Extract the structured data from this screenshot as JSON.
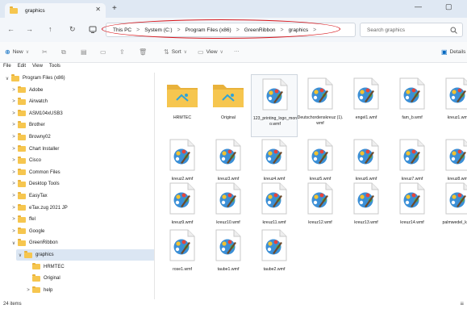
{
  "window": {
    "tab_title": "graphics",
    "close_glyph": "✕",
    "new_tab_glyph": "+",
    "minimize_glyph": "—",
    "maximize_glyph": "▢"
  },
  "nav": {
    "back": "←",
    "forward": "→",
    "up": "↑",
    "refresh": "↻",
    "breadcrumb": [
      "This PC",
      "System (C:)",
      "Program Files (x86)",
      "GreenRibbon",
      "graphics"
    ],
    "separator": ">",
    "search_placeholder": "Search graphics",
    "highlight_color": "#d6151b"
  },
  "toolbar": {
    "new_label": "New",
    "sort_label": "Sort",
    "view_label": "View",
    "more_label": "···",
    "details_label": "Details"
  },
  "menubar": [
    "File",
    "Edit",
    "View",
    "Tools"
  ],
  "sidebar": {
    "items": [
      {
        "label": "Program Files (x86)",
        "chev": "∨"
      },
      {
        "label": "Adobe",
        "chev": ">"
      },
      {
        "label": "Airwatch",
        "chev": ">"
      },
      {
        "label": "ASM104xUSB3",
        "chev": ">"
      },
      {
        "label": "Brother",
        "chev": ">"
      },
      {
        "label": "Browny02",
        "chev": ">"
      },
      {
        "label": "Chart Installer",
        "chev": ">"
      },
      {
        "label": "Cisco",
        "chev": ">"
      },
      {
        "label": "Common Files",
        "chev": ">"
      },
      {
        "label": "Desktop Tools",
        "chev": ">"
      },
      {
        "label": "EasyTax",
        "chev": ">"
      },
      {
        "label": "eTax.zug 2021 JP",
        "chev": ">"
      },
      {
        "label": "ffel",
        "chev": ">"
      },
      {
        "label": "Google",
        "chev": ">"
      },
      {
        "label": "GreenRibbon",
        "chev": "∨"
      },
      {
        "label": "graphics",
        "chev": "∨"
      },
      {
        "label": "HRMTEC",
        "chev": ""
      },
      {
        "label": "Original",
        "chev": ""
      },
      {
        "label": "help",
        "chev": ">"
      }
    ]
  },
  "files": [
    {
      "name": "HRMTEC",
      "type": "folder"
    },
    {
      "name": "Original",
      "type": "folder"
    },
    {
      "name": "123_printing_logo_mono.wmf",
      "type": "wmf"
    },
    {
      "name": "Deutschordenskreuz (1).wmf",
      "type": "wmf"
    },
    {
      "name": "engel1.wmf",
      "type": "wmf"
    },
    {
      "name": "fam_b.wmf",
      "type": "wmf"
    },
    {
      "name": "kreuz1.wmf",
      "type": "wmf"
    },
    {
      "name": "kreuz2.wmf",
      "type": "wmf"
    },
    {
      "name": "kreuz3.wmf",
      "type": "wmf"
    },
    {
      "name": "kreuz4.wmf",
      "type": "wmf"
    },
    {
      "name": "kreuz5.wmf",
      "type": "wmf"
    },
    {
      "name": "kreuz6.wmf",
      "type": "wmf"
    },
    {
      "name": "kreuz7.wmf",
      "type": "wmf"
    },
    {
      "name": "kreuz8.wmf",
      "type": "wmf"
    },
    {
      "name": "kreuz9.wmf",
      "type": "wmf"
    },
    {
      "name": "kreuz10.wmf",
      "type": "wmf"
    },
    {
      "name": "kreuz11.wmf",
      "type": "wmf"
    },
    {
      "name": "kreuz12.wmf",
      "type": "wmf"
    },
    {
      "name": "kreuz13.wmf",
      "type": "wmf"
    },
    {
      "name": "kreuz14.wmf",
      "type": "wmf"
    },
    {
      "name": "palmwedel_kumf",
      "type": "wmf"
    },
    {
      "name": "rose1.wmf",
      "type": "wmf"
    },
    {
      "name": "taube1.wmf",
      "type": "wmf"
    },
    {
      "name": "taube2.wmf",
      "type": "wmf"
    }
  ],
  "status": {
    "item_count": "24 items",
    "view_glyph": "≡"
  },
  "colors": {
    "folder": "#f6c64f",
    "accent": "#0067c0"
  }
}
